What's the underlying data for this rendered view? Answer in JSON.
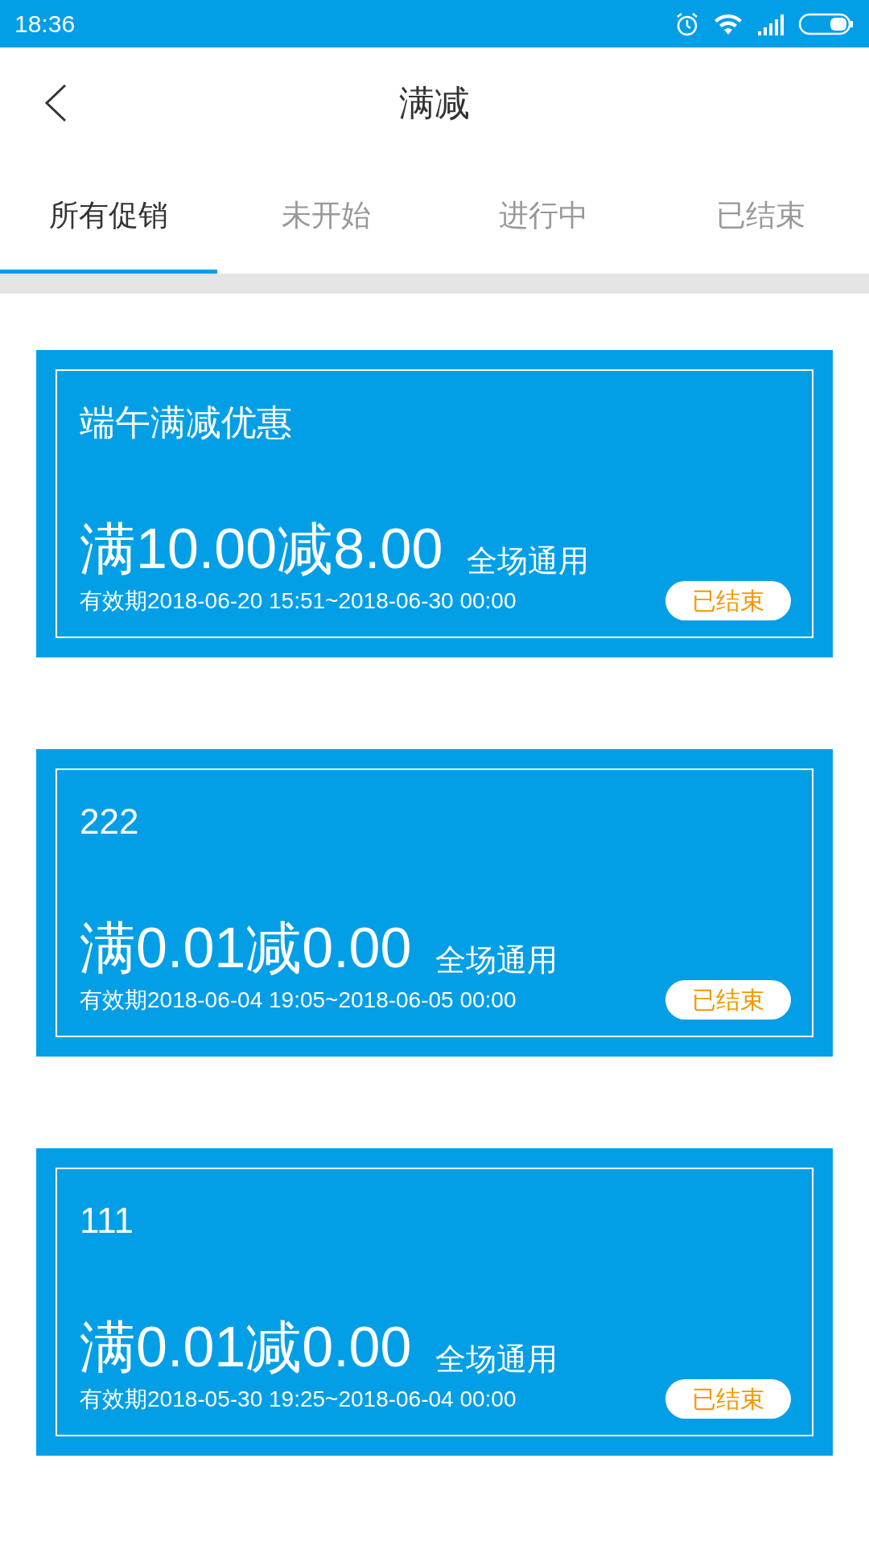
{
  "status_bar": {
    "time": "18:36"
  },
  "header": {
    "title": "满减"
  },
  "tabs": [
    {
      "label": "所有促销",
      "selected": true
    },
    {
      "label": "未开始",
      "selected": false
    },
    {
      "label": "进行中",
      "selected": false
    },
    {
      "label": "已结束",
      "selected": false
    }
  ],
  "promotions": [
    {
      "name": "端午满减优惠",
      "rule": "满10.00减8.00",
      "scope": "全场通用",
      "validity": "有效期2018-06-20 15:51~2018-06-30 00:00",
      "status": "已结束"
    },
    {
      "name": "222",
      "rule": "满0.01减0.00",
      "scope": "全场通用",
      "validity": "有效期2018-06-04 19:05~2018-06-05 00:00",
      "status": "已结束"
    },
    {
      "name": "111",
      "rule": "满0.01减0.00",
      "scope": "全场通用",
      "validity": "有效期2018-05-30 19:25~2018-06-04 00:00",
      "status": "已结束"
    }
  ]
}
